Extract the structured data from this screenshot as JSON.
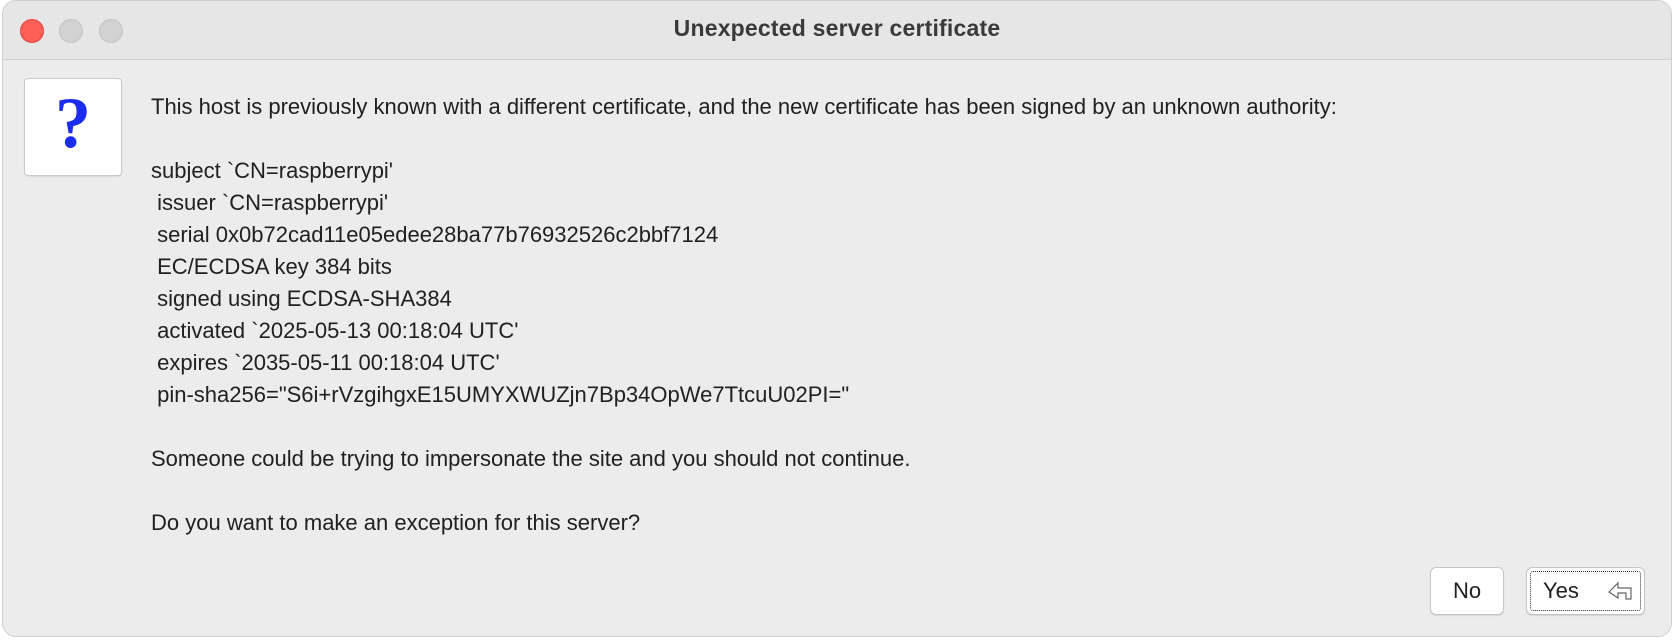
{
  "window": {
    "title": "Unexpected server certificate"
  },
  "icon": {
    "glyph": "?",
    "name": "question-icon",
    "color": "#1a2df0"
  },
  "message": {
    "intro": "This host is previously known with a different certificate, and the new certificate has been signed by an unknown authority:",
    "certificate_lines": [
      "subject `CN=raspberrypi'",
      " issuer `CN=raspberrypi'",
      " serial 0x0b72cad11e05edee28ba77b76932526c2bbf7124",
      " EC/ECDSA key 384 bits",
      " signed using ECDSA-SHA384",
      " activated `2025-05-13 00:18:04 UTC'",
      " expires `2035-05-11 00:18:04 UTC'",
      " pin-sha256=\"S6i+rVzgihgxE15UMYXWUZjn7Bp34OpWe7TtcuU02PI=\""
    ],
    "warning": "Someone could be trying to impersonate the site and you should not continue.",
    "question": "Do you want to make an exception for this server?"
  },
  "buttons": {
    "no_label": "No",
    "yes_label": "Yes"
  },
  "colors": {
    "close": "#fe5f57",
    "inactive_traffic": "#d2d2d2",
    "background": "#ececec"
  }
}
